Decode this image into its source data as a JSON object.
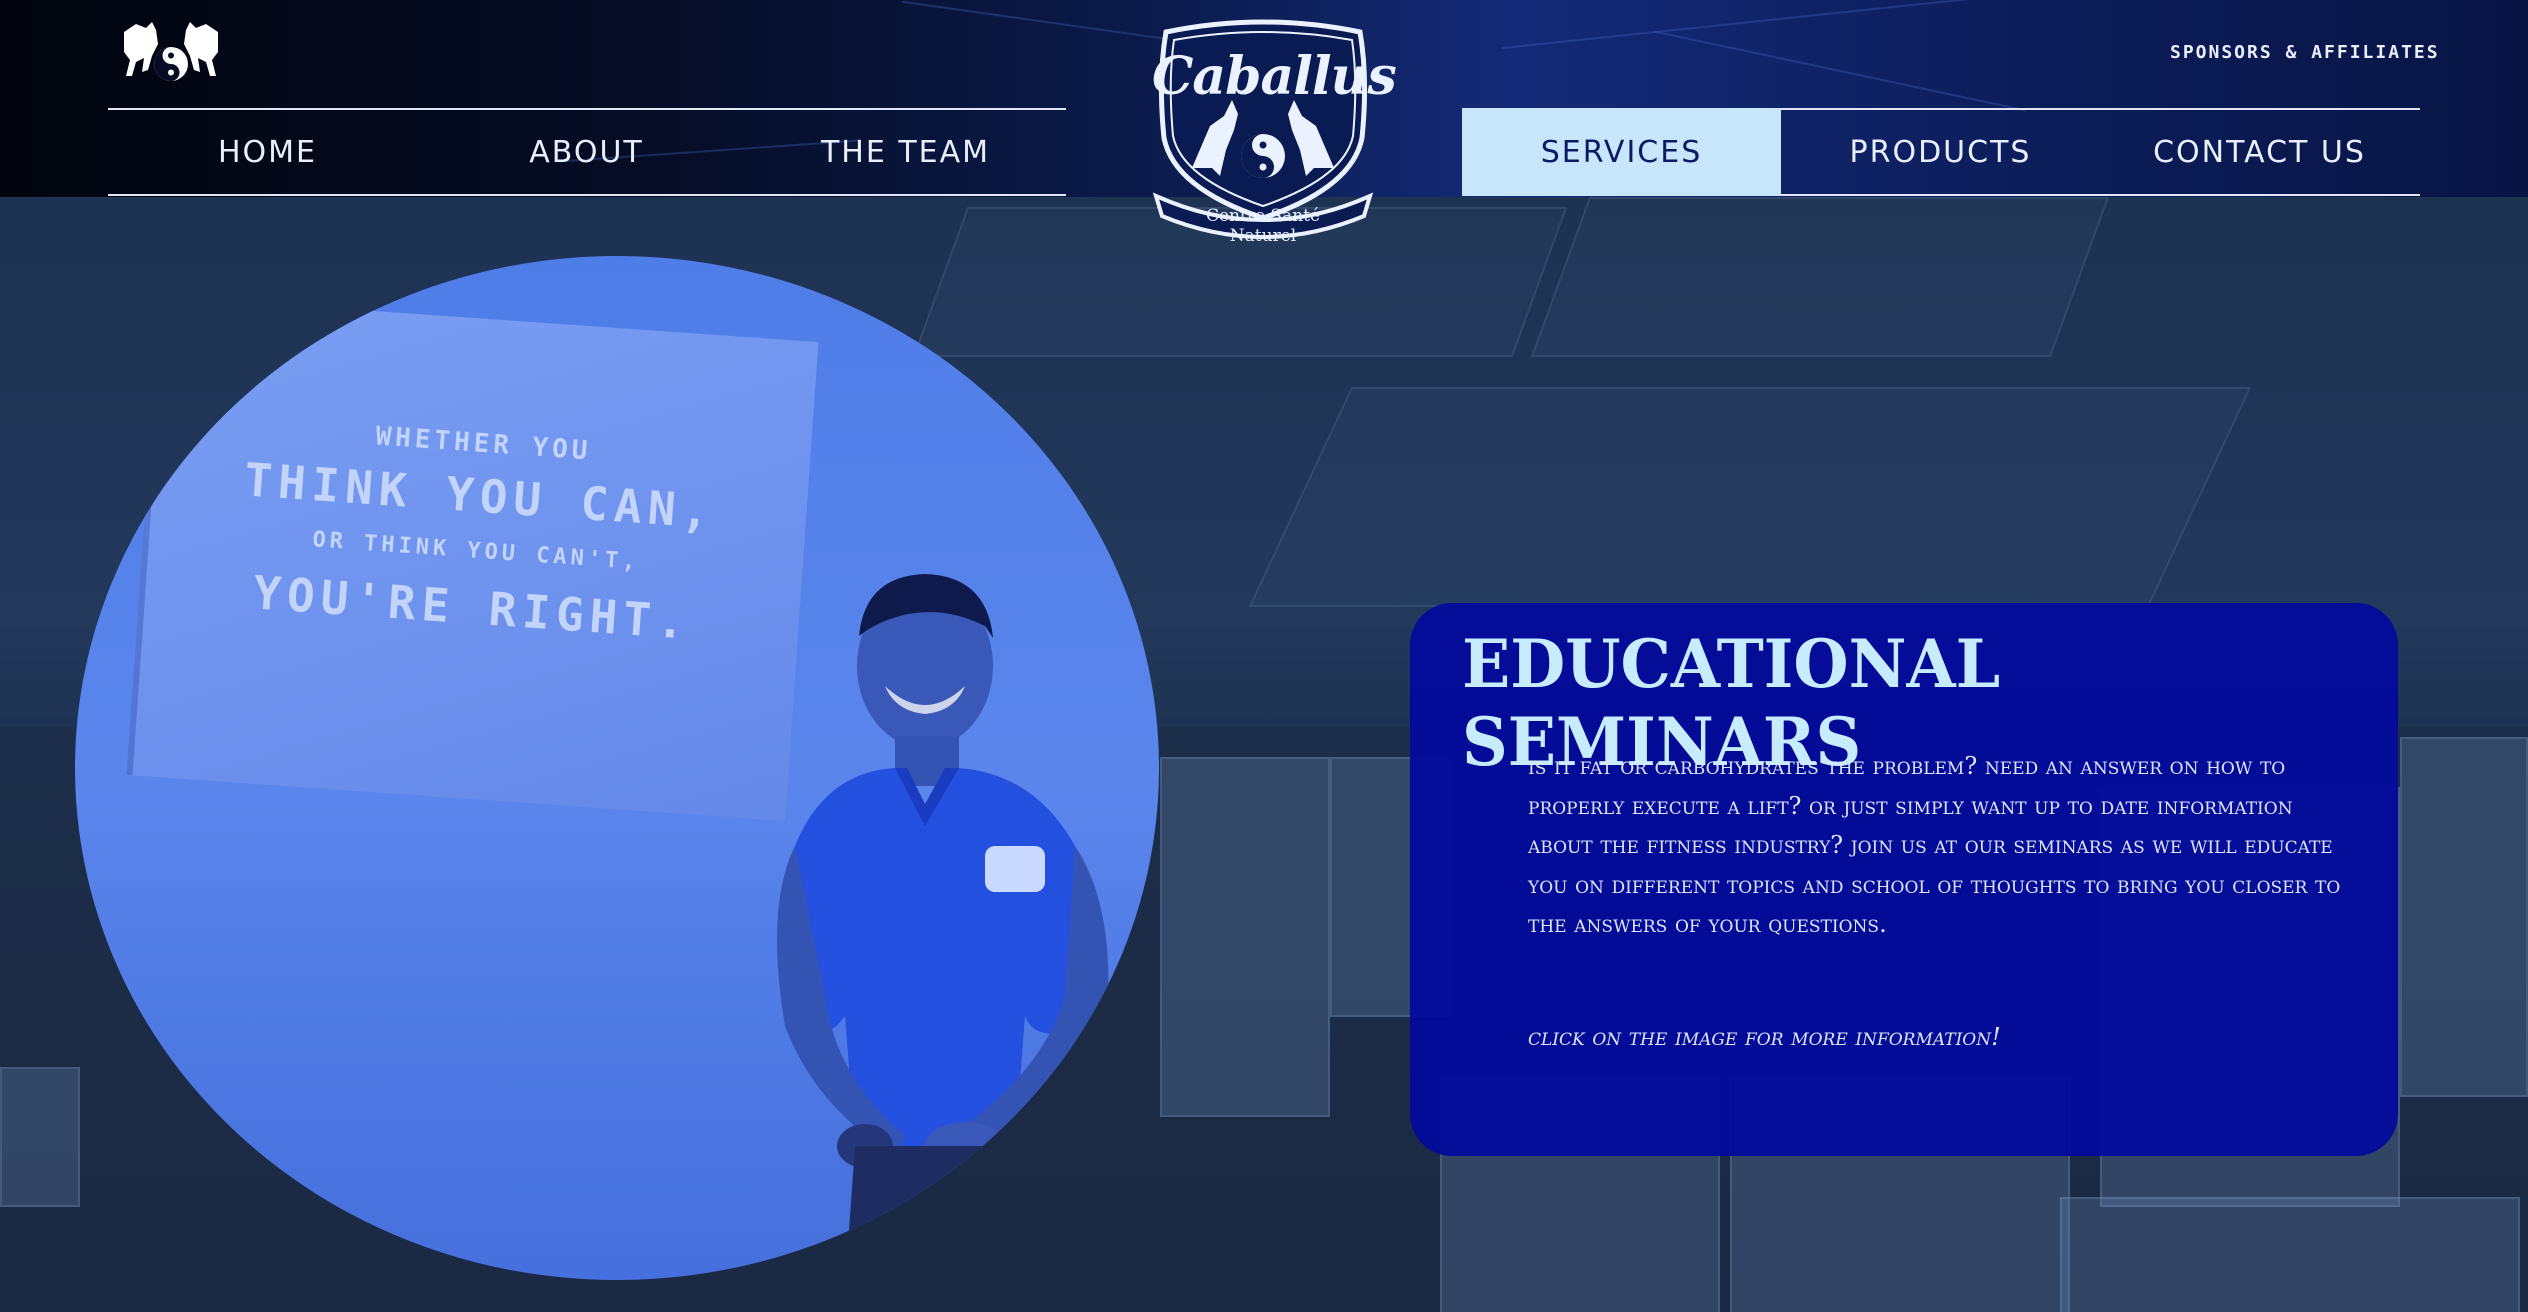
{
  "header": {
    "sponsors_label": "SPONSORS & AFFILIATES",
    "nav_left": [
      {
        "label": "HOME",
        "active": false
      },
      {
        "label": "ABOUT",
        "active": false
      },
      {
        "label": "THE TEAM",
        "active": false
      }
    ],
    "nav_right": [
      {
        "label": "SERVICES",
        "active": true
      },
      {
        "label": "PRODUCTS",
        "active": false
      },
      {
        "label": "CONTACT US",
        "active": false
      }
    ],
    "crest": {
      "title": "Caballus",
      "subtitle": "Centre Santé Naturel"
    }
  },
  "photo": {
    "screen_lines": [
      "WHETHER YOU",
      "THINK YOU CAN,",
      "OR THINK YOU CAN'T,",
      "YOU'RE RIGHT."
    ]
  },
  "card": {
    "title": "EDUCATIONAL SEMINARS",
    "body": "Is it fat or carbohydrates the problem? Need an answer on how to properly execute a lift? Or just simply want up to date information about the fitness industry?  Join us at our seminars as we will educate you on different topics and school of thoughts to bring you closer to the answers of your questions.",
    "note": "Click on the image for more information!"
  },
  "colors": {
    "card_bg": "#030a9b",
    "title": "#c8ecff",
    "active_nav": "#c8e6fb",
    "photo_tint": "#5a86ec"
  }
}
